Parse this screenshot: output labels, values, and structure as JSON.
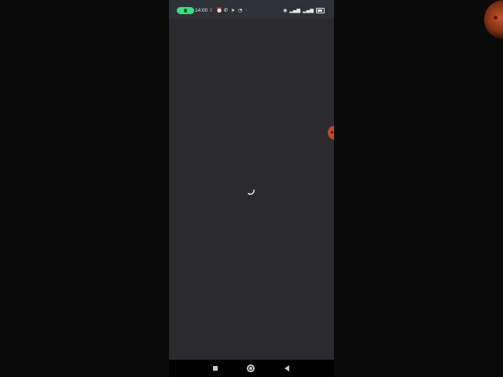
{
  "status_bar": {
    "time": "14:00",
    "notification_icons": [
      "moon-icon",
      "alarm-icon",
      "whatsapp-icon",
      "telegram-icon",
      "clock-icon",
      "more-dots-icon"
    ],
    "system_icons": [
      "eye-icon",
      "volte-signal-icon",
      "signal-icon",
      "battery-icon"
    ],
    "call_indicator_color": "#3ddc84",
    "battery_level": 0.8
  },
  "content": {
    "state": "loading",
    "background": "#2b2b2d"
  },
  "floating_bubble": {
    "color": "#b84a2a"
  },
  "nav_bar": {
    "buttons": [
      "recents",
      "home",
      "back"
    ]
  }
}
